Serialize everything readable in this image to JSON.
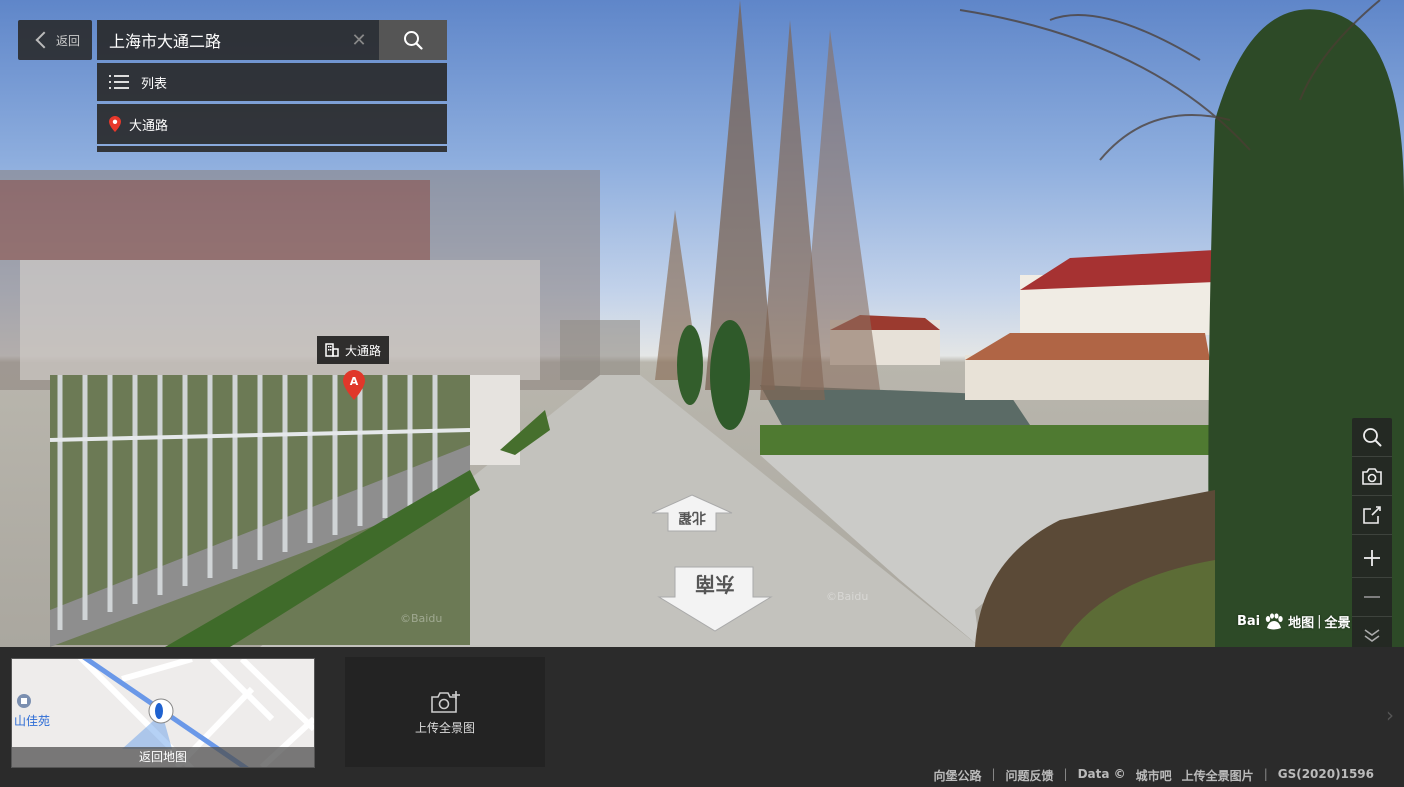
{
  "search": {
    "back_label": "返回",
    "query": "上海市大通二路",
    "list_label": "列表",
    "result_label": "大通路"
  },
  "pano": {
    "poi_label": "大通路",
    "marker_letter": "A",
    "arrow_forward_label": "北翟",
    "arrow_back_label": "东南",
    "watermark": "Baidu"
  },
  "toolbar": {
    "icons": [
      "search-icon",
      "camera-icon",
      "share-icon",
      "zoom-in-icon",
      "zoom-out-icon",
      "collapse-icon"
    ]
  },
  "logo": {
    "brand": "Bai",
    "map": "地图",
    "pano": "全景"
  },
  "bottom": {
    "mini_map_poi": "山佳苑",
    "back_to_map": "返回地图",
    "upload_label": "上传全景图",
    "footer": [
      "向堡公路",
      "问题反馈",
      "Data ©",
      "城市吧",
      "上传全景图片",
      "GS(2020)1596"
    ]
  }
}
